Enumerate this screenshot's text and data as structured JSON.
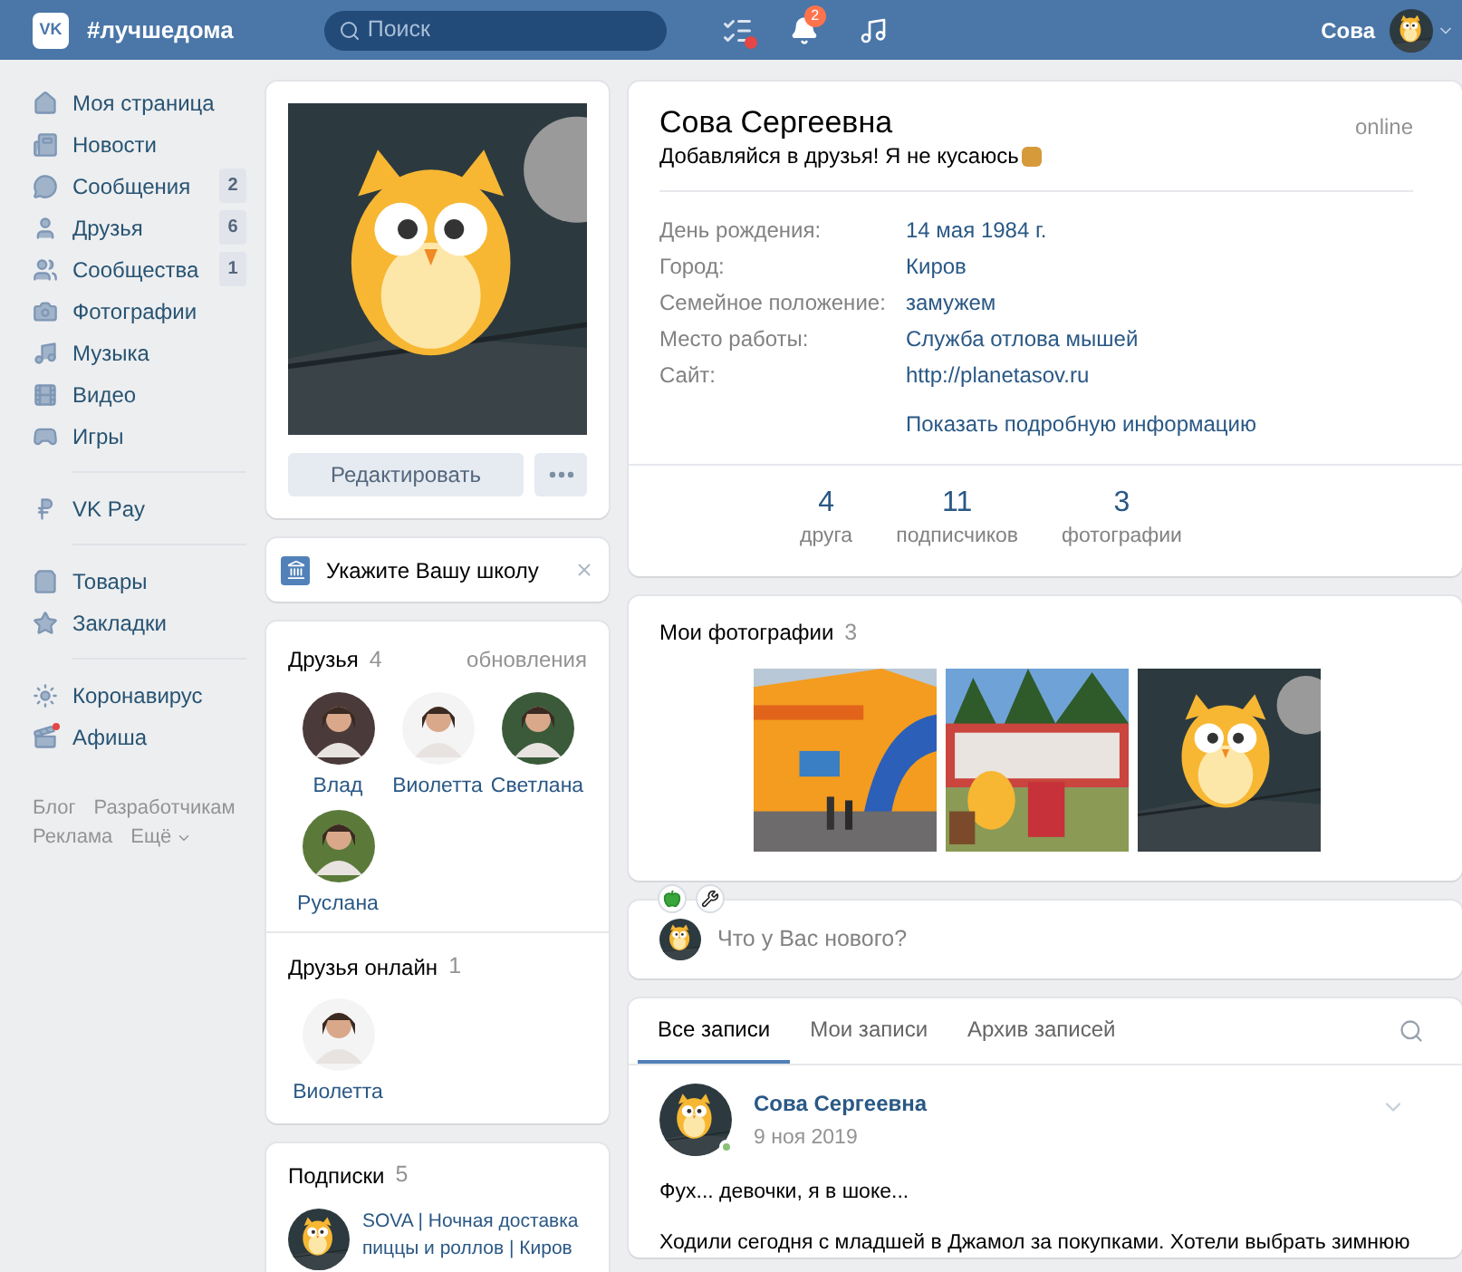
{
  "header": {
    "logo": "VK",
    "hashtag": "#лучшедома",
    "search": {
      "placeholder": "Поиск"
    },
    "notifications_badge": "2",
    "tasks_alert": true,
    "user_name": "Сова"
  },
  "nav": {
    "groups": [
      [
        {
          "label": "Моя страница",
          "unread": false
        },
        {
          "label": "Новости",
          "unread": false
        },
        {
          "label": "Сообщения",
          "count": "2",
          "unread": false
        },
        {
          "label": "Друзья",
          "count": "6",
          "unread": false
        },
        {
          "label": "Сообщества",
          "count": "1",
          "unread": false
        },
        {
          "label": "Фотографии",
          "unread": false
        },
        {
          "label": "Музыка",
          "unread": false
        },
        {
          "label": "Видео",
          "unread": false
        },
        {
          "label": "Игры",
          "unread": false
        }
      ],
      [
        {
          "label": "VK Pay",
          "unread": false
        }
      ],
      [
        {
          "label": "Товары",
          "unread": false
        },
        {
          "label": "Закладки",
          "unread": false
        }
      ],
      [
        {
          "label": "Коронавирус",
          "unread": false
        },
        {
          "label": "Афиша",
          "unread": true
        }
      ]
    ],
    "footer_links": [
      "Блог",
      "Разработчикам",
      "Реклама",
      "Ещё"
    ]
  },
  "profile": {
    "edit_button": "Редактировать"
  },
  "school_prompt": {
    "text": "Укажите Вашу школу"
  },
  "friends": {
    "title": "Друзья",
    "count": "4",
    "link": "обновления",
    "people": [
      {
        "name": "Влад"
      },
      {
        "name": "Виолетта"
      },
      {
        "name": "Светлана"
      },
      {
        "name": "Руслана"
      }
    ]
  },
  "friends_online": {
    "title": "Друзья онлайн",
    "count": "1",
    "people": [
      {
        "name": "Виолетта"
      }
    ]
  },
  "subscriptions": {
    "title": "Подписки",
    "count": "5",
    "items": [
      {
        "name": "SOVA | Ночная доставка пиццы и роллов | Киров"
      }
    ]
  },
  "info": {
    "name": "Сова Сергеевна",
    "status": "Добавляйся в друзья! Я не кусаюсь",
    "online": "online",
    "fields": [
      {
        "label": "День рождения:",
        "value": "14 мая 1984 г."
      },
      {
        "label": "Город:",
        "value": "Киров"
      },
      {
        "label": "Семейное положение:",
        "value": "замужем"
      },
      {
        "label": "Место работы:",
        "value": "Служба отлова мышей"
      },
      {
        "label": "Сайт:",
        "value": "http://planetasov.ru"
      }
    ],
    "more_link": "Показать подробную информацию",
    "counters": [
      {
        "value": "4",
        "label": "друга"
      },
      {
        "value": "11",
        "label": "подписчиков"
      },
      {
        "value": "3",
        "label": "фотографии"
      }
    ]
  },
  "photos": {
    "title": "Мои фотографии",
    "count": "3"
  },
  "composer": {
    "placeholder": "Что у Вас нового?"
  },
  "wall": {
    "tabs": [
      {
        "label": "Все записи",
        "selected": true
      },
      {
        "label": "Мои записи",
        "selected": false
      },
      {
        "label": "Архив записей",
        "selected": false
      }
    ],
    "post": {
      "author": "Сова Сергеевна",
      "online": true,
      "date": "9 ноя 2019",
      "paragraphs": [
        "Фух... девочки, я в шоке...",
        "Ходили сегодня с младшей в Джамол за покупками. Хотели выбрать зимнюю"
      ]
    }
  }
}
